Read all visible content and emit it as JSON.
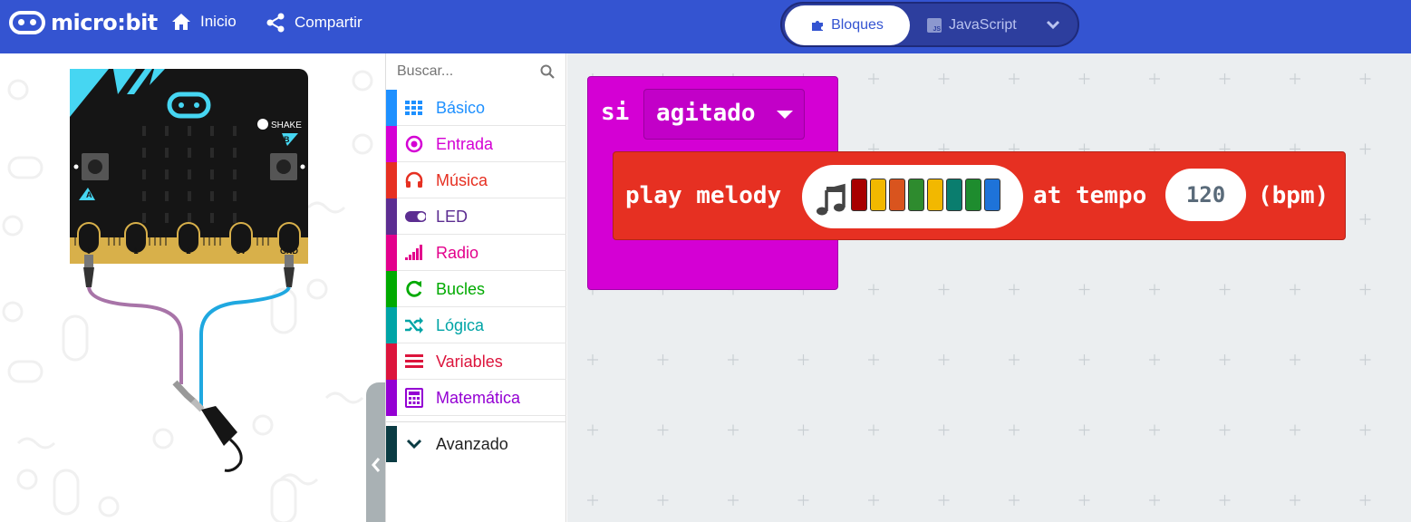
{
  "header": {
    "logo_text": "micro:bit",
    "home_label": "Inicio",
    "share_label": "Compartir",
    "blocks_label": "Bloques",
    "javascript_label": "JavaScript"
  },
  "simulator": {
    "shake_label": "SHAKE",
    "button_a": "A",
    "button_b": "B",
    "pins": [
      "0",
      "1",
      "2",
      "3V",
      "GND"
    ]
  },
  "toolbox": {
    "search_placeholder": "Buscar...",
    "categories": [
      {
        "label": "Básico",
        "color": "#1e90ff",
        "icon": "grid-icon"
      },
      {
        "label": "Entrada",
        "color": "#d400d4",
        "icon": "target-icon"
      },
      {
        "label": "Música",
        "color": "#e63022",
        "icon": "headphones-icon"
      },
      {
        "label": "LED",
        "color": "#5c2d91",
        "icon": "toggle-icon"
      },
      {
        "label": "Radio",
        "color": "#e3008c",
        "icon": "signal-icon"
      },
      {
        "label": "Bucles",
        "color": "#00aa00",
        "icon": "refresh-icon"
      },
      {
        "label": "Lógica",
        "color": "#00a4a6",
        "icon": "shuffle-icon"
      },
      {
        "label": "Variables",
        "color": "#dc143c",
        "icon": "list-icon"
      },
      {
        "label": "Matemática",
        "color": "#9400d3",
        "icon": "calculator-icon"
      }
    ],
    "advanced_label": "Avanzado",
    "advanced_color": "#0a3b43"
  },
  "workspace": {
    "event_keyword": "si",
    "event_value": "agitado",
    "play_label": "play melody",
    "at_tempo_label": "at tempo",
    "tempo_value": "120",
    "bpm_label": "(bpm)",
    "melody_colors": [
      "#a80000",
      "#f2b800",
      "#d9541e",
      "#2e8b2e",
      "#f2b800",
      "#0a7d6e",
      "#1e8c2e",
      "#1e73d9"
    ]
  }
}
